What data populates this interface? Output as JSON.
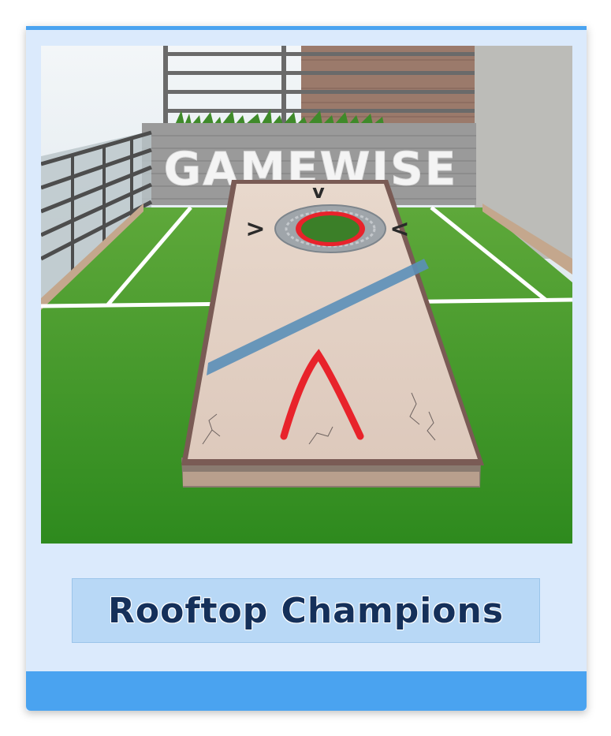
{
  "card": {
    "title": "Rooftop Champions",
    "accent_color": "#4aa3f0",
    "title_color": "#15305a"
  },
  "scene": {
    "wall_text": "GAMEWISE",
    "board_arrows": [
      ">",
      "v",
      "<"
    ],
    "board_stripe_color": "#5b8fb8",
    "board_mark_color": "#e8232b"
  }
}
